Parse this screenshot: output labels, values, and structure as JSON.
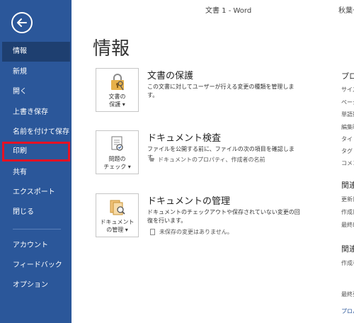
{
  "window": {
    "title": "文書 1  -  Word",
    "user": "秋葉一"
  },
  "sidebar": {
    "items": [
      {
        "label": "情報"
      },
      {
        "label": "新規"
      },
      {
        "label": "開く"
      },
      {
        "label": "上書き保存"
      },
      {
        "label": "名前を付けて保存"
      },
      {
        "label": "印刷"
      },
      {
        "label": "共有"
      },
      {
        "label": "エクスポート"
      },
      {
        "label": "閉じる"
      },
      {
        "label": "アカウント"
      },
      {
        "label": "フィードバック"
      },
      {
        "label": "オプション"
      }
    ]
  },
  "main": {
    "title": "情報",
    "cards": [
      {
        "button_label": "文書の\n保護 ▾",
        "heading": "文書の保護",
        "description": "この文書に対してユーザーが行える変更の種類を管理します。"
      },
      {
        "button_label": "問題の\nチェック ▾",
        "heading": "ドキュメント検査",
        "description": "ファイルを公開する前に、ファイルの次の項目を確認します。",
        "sub": "ドキュメントのプロパティ、作成者の名前"
      },
      {
        "button_label": "ドキュメント\nの管理 ▾",
        "heading": "ドキュメントの管理",
        "description": "ドキュメントのチェックアウトや保存されていない変更の回復を行います。",
        "sub": "未保存の変更はありません。"
      }
    ]
  },
  "properties": {
    "heading": "プロパティ",
    "items": [
      "サイズ",
      "ページ数",
      "単語数",
      "編集時間",
      "タイトル",
      "タグ",
      "コメント"
    ],
    "related_dates": "関連する日付",
    "date_items": [
      "更新日時",
      "作成日時",
      "最終印刷日"
    ],
    "related_people": "関連ユーザー",
    "people_items": [
      "作成者",
      "最終更新者"
    ],
    "link": "プロパティをすべて表示"
  },
  "colors": {
    "sidebar": "#2b579a",
    "highlight": "#e81123",
    "selected": "#1e3f70"
  }
}
